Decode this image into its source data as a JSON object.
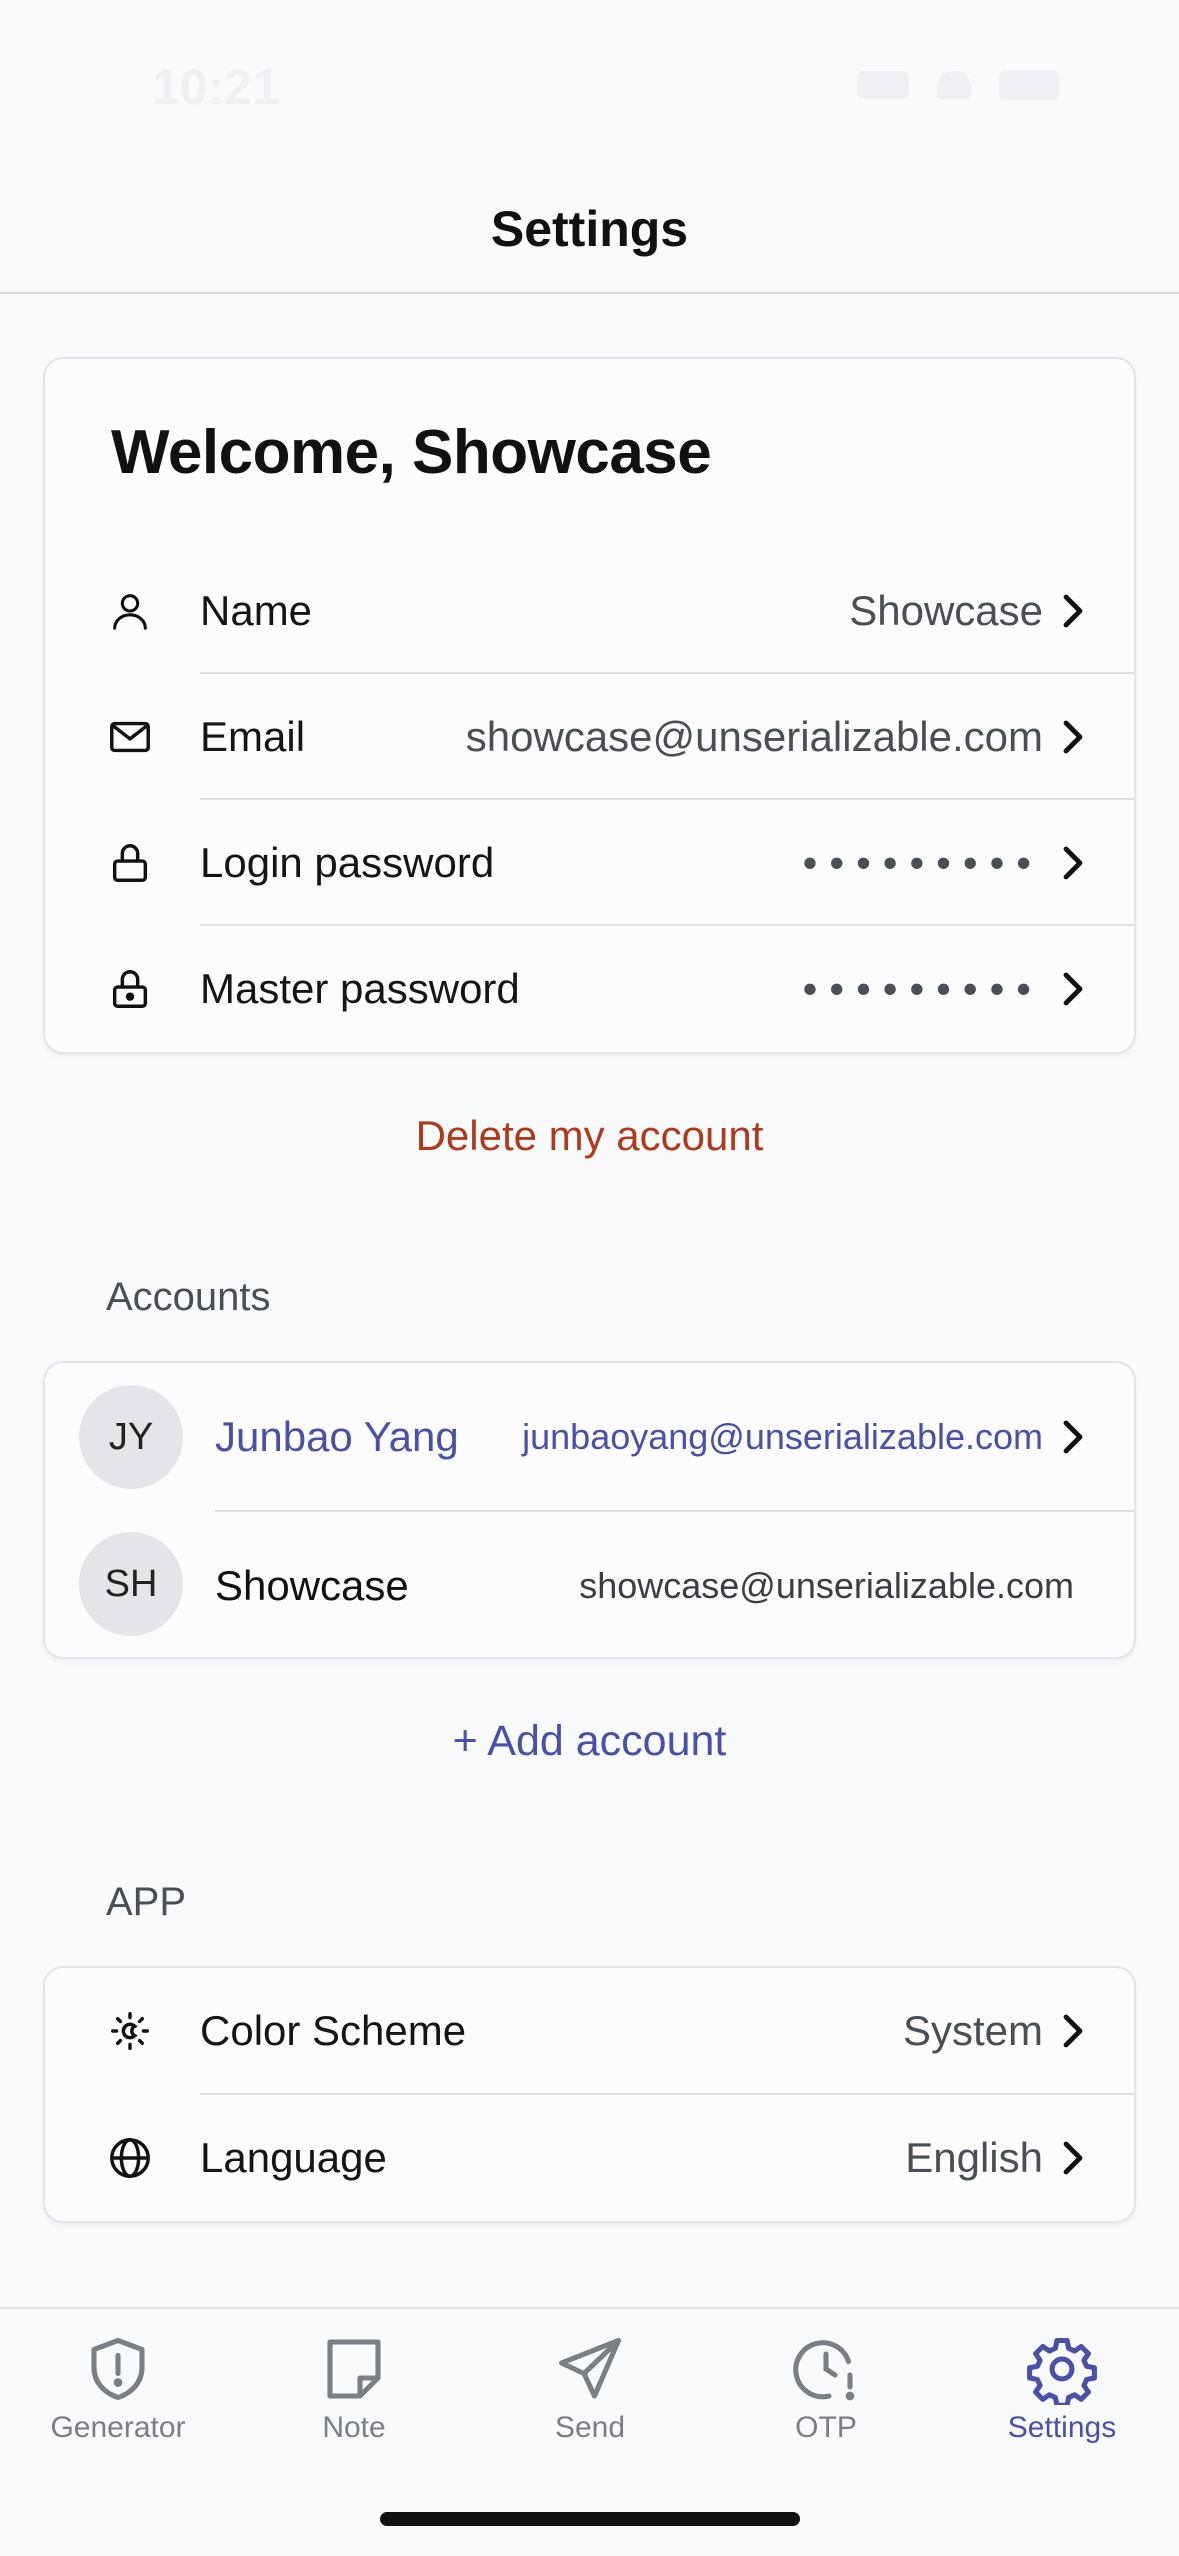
{
  "status_bar": {
    "time": "10:21"
  },
  "header": {
    "title": "Settings"
  },
  "profile_card": {
    "welcome": "Welcome, Showcase",
    "rows": [
      {
        "label": "Name",
        "value": "Showcase",
        "icon": "person-icon"
      },
      {
        "label": "Email",
        "value": "showcase@unserializable.com",
        "icon": "mail-icon"
      },
      {
        "label": "Login password",
        "value": "•••••••••",
        "icon": "lock-open-icon"
      },
      {
        "label": "Master password",
        "value": "•••••••••",
        "icon": "lock-closed-icon"
      }
    ]
  },
  "delete_account": "Delete my account",
  "accounts": {
    "section_label": "Accounts",
    "items": [
      {
        "initials": "JY",
        "name": "Junbao Yang",
        "email": "junbaoyang@unserializable.com",
        "active": true
      },
      {
        "initials": "SH",
        "name": "Showcase",
        "email": "showcase@unserializable.com",
        "active": false
      }
    ],
    "add_label": "+ Add account"
  },
  "app": {
    "section_label": "APP",
    "rows": [
      {
        "label": "Color Scheme",
        "value": "System",
        "icon": "sun-moon-icon"
      },
      {
        "label": "Language",
        "value": "English",
        "icon": "globe-icon"
      }
    ]
  },
  "tabs": [
    {
      "label": "Generator",
      "icon": "shield-icon",
      "active": false
    },
    {
      "label": "Note",
      "icon": "note-icon",
      "active": false
    },
    {
      "label": "Send",
      "icon": "send-icon",
      "active": false
    },
    {
      "label": "OTP",
      "icon": "clock-alert-icon",
      "active": false
    },
    {
      "label": "Settings",
      "icon": "gear-icon",
      "active": true
    }
  ],
  "colors": {
    "accent": "#4a50a8",
    "danger": "#b0391a",
    "background": "#f9fafc"
  }
}
